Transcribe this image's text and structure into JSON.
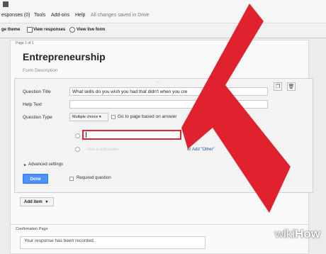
{
  "menu": {
    "items": [
      "esponses (0)",
      "Tools",
      "Add-ons",
      "Help"
    ],
    "saved_status": "All changes saved in Drive"
  },
  "toolbar": {
    "theme": "ge theme",
    "view_responses": "View responses",
    "view_live": "View live form"
  },
  "page": {
    "page_of": "Page 1 of 1",
    "title": "Entrepreneurship",
    "description": "Form Description"
  },
  "question": {
    "title_label": "Question Title",
    "title_value": "What skills do you wish you had that didn't when you cre",
    "help_label": "Help Text",
    "help_value": "",
    "type_label": "Question Type",
    "type_value": "Multiple choice",
    "goto_label": "Go to page based on answer",
    "add_option": "Click to add option",
    "or_text": "or",
    "add_other": "Add \"Other\"",
    "advanced": "Advanced settings",
    "done": "Done",
    "required": "Required question"
  },
  "add_item": "Add item",
  "confirmation": {
    "label": "Confirmation Page",
    "text": "Your response has been recorded."
  },
  "watermark": {
    "wiki": "wiki",
    "how": "How"
  },
  "colors": {
    "arrow": "#e0222e",
    "done_button": "#4d90fe",
    "link": "#2255aa"
  }
}
